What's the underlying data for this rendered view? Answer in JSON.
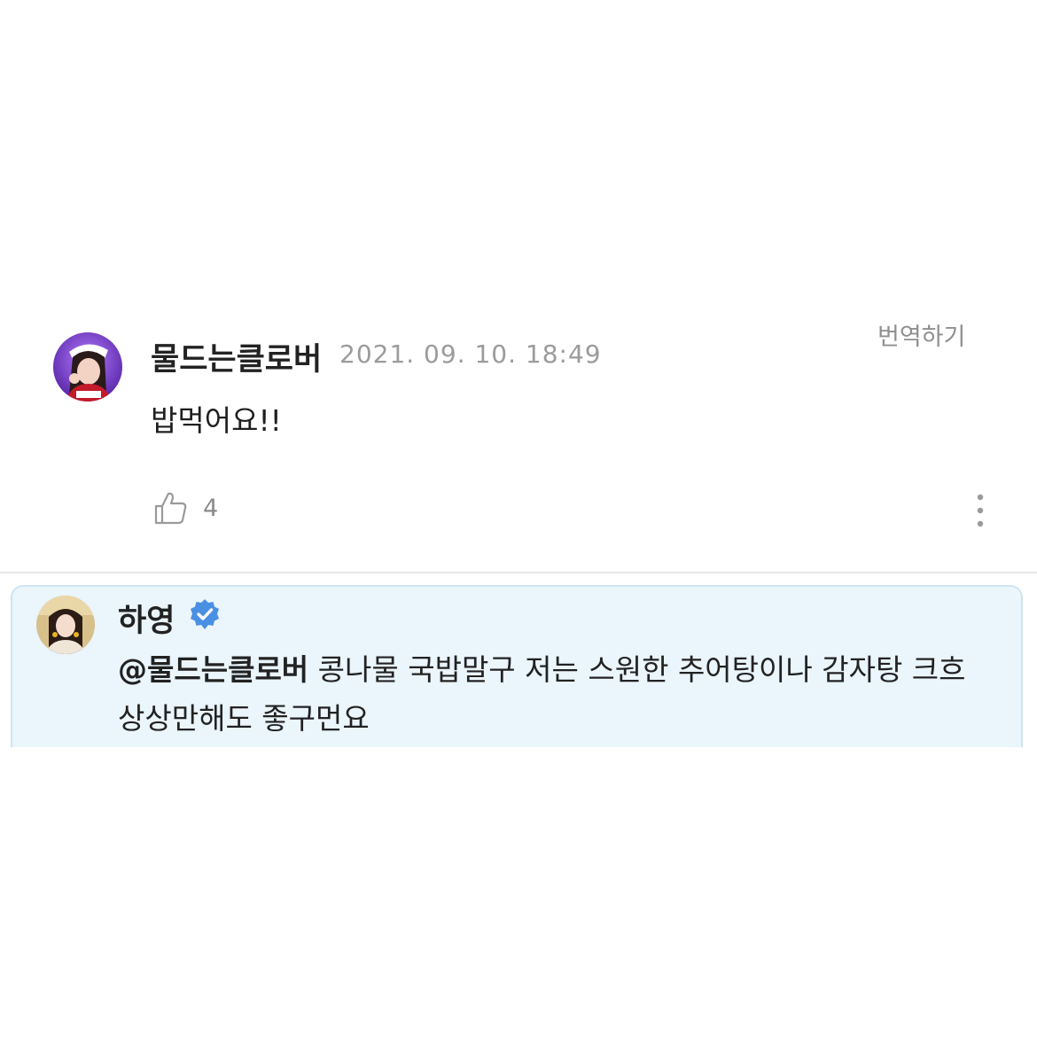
{
  "comment": {
    "author": "물드는클로버",
    "timestamp": "2021. 09. 10. 18:49",
    "translate_label": "번역하기",
    "text": "밥먹어요!!",
    "likes": "4",
    "avatar": "user-avatar"
  },
  "reply": {
    "author": "하영",
    "verified": true,
    "mention": "@물드는클로버",
    "text": " 콩나물 국밥말구 저는 스원한 추어탕이나 감자탕 크흐 상상만해도 좋구먼요",
    "avatar": "artist-avatar",
    "background_color": "#eaf5fc",
    "verified_color": "#4a90e2"
  }
}
